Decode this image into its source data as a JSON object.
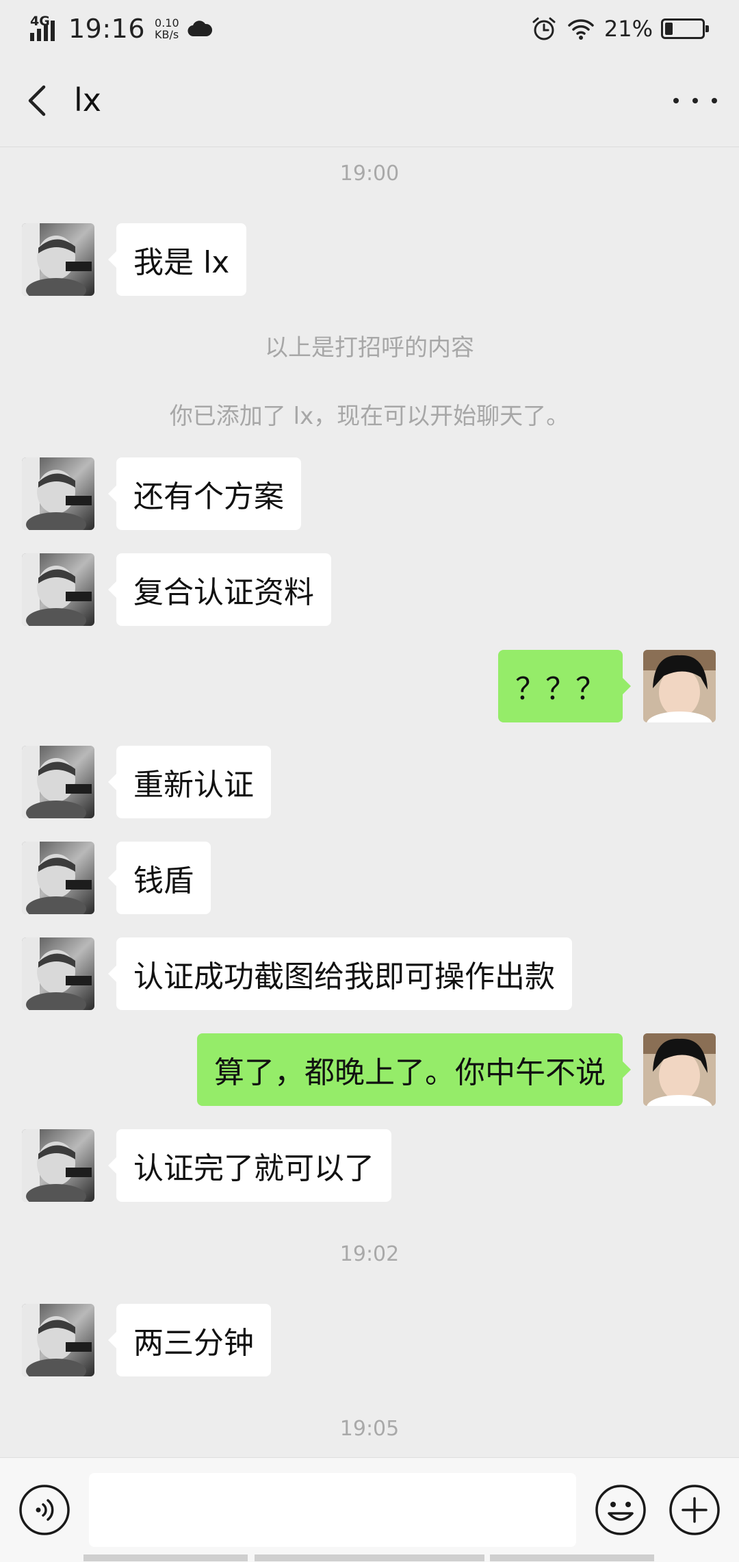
{
  "status_bar": {
    "network": "4G",
    "time": "19:16",
    "speed_value": "0.10",
    "speed_unit": "KB/s",
    "battery_percent": "21%",
    "battery_level": 0.21
  },
  "header": {
    "title": "lx"
  },
  "chat": {
    "timestamp_1": "19:00",
    "msg_1": "我是 lx",
    "system_1": "以上是打招呼的内容",
    "system_2": "你已添加了 lx，现在可以开始聊天了。",
    "msg_2": "还有个方案",
    "msg_3": "复合认证资料",
    "msg_4": "？？？",
    "msg_5": "重新认证",
    "msg_6": "钱盾",
    "msg_7": "认证成功截图给我即可操作出款",
    "msg_8": "算了，都晚上了。你中午不说",
    "msg_9": "认证完了就可以了",
    "timestamp_2": "19:02",
    "msg_10": "两三分钟",
    "timestamp_3": "19:05"
  },
  "input_bar": {
    "value": "",
    "icons": [
      "voice-icon",
      "emoji-icon",
      "plus-icon"
    ]
  },
  "colors": {
    "background": "#ededed",
    "incoming_bubble": "#ffffff",
    "outgoing_bubble": "#95ec69",
    "timestamp": "#a9a9a9"
  }
}
